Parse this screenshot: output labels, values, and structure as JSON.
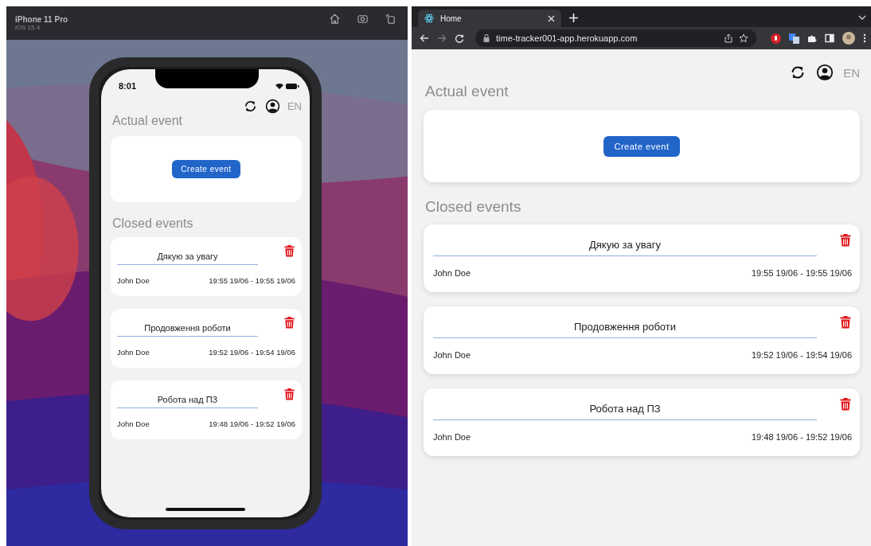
{
  "simulator": {
    "device": "iPhone 11 Pro",
    "os": "iOS 15.4"
  },
  "phone": {
    "time": "8:01"
  },
  "phone_app": {
    "language": "EN",
    "actual_title": "Actual event",
    "create_button": "Create event",
    "closed_title": "Closed events",
    "events": [
      {
        "title": "Дякую за увагу",
        "user": "John Doe",
        "period": "19:55 19/06 - 19:55 19/06"
      },
      {
        "title": "Продовження роботи",
        "user": "John Doe",
        "period": "19:52 19/06 - 19:54 19/06"
      },
      {
        "title": "Робота над ПЗ",
        "user": "John Doe",
        "period": "19:48 19/06 - 19:52 19/06"
      }
    ]
  },
  "browser": {
    "tabs": [
      {
        "title": "Home",
        "selected": true
      }
    ],
    "url": "time-tracker001-app.herokuapp.com"
  },
  "web_app": {
    "language": "EN",
    "actual_title": "Actual event",
    "create_button": "Create event",
    "closed_title": "Closed events",
    "events": [
      {
        "title": "Дякую за увагу",
        "user": "John Doe",
        "period": "19:55 19/06 - 19:55 19/06"
      },
      {
        "title": "Продовження роботи",
        "user": "John Doe",
        "period": "19:52 19/06 - 19:54 19/06"
      },
      {
        "title": "Робота над ПЗ",
        "user": "John Doe",
        "period": "19:48 19/06 - 19:52 19/06"
      }
    ]
  }
}
